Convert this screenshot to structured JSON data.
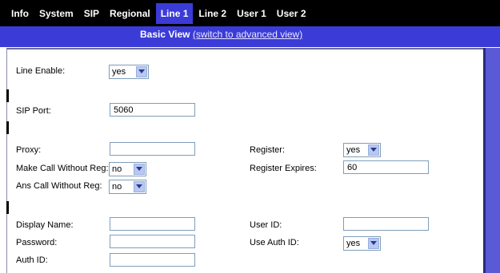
{
  "tabs": [
    "Info",
    "System",
    "SIP",
    "Regional",
    "Line 1",
    "Line 2",
    "User 1",
    "User 2"
  ],
  "active_tab": "Line 1",
  "view": {
    "title": "Basic View",
    "switch_link": "(switch to advanced view)"
  },
  "fields": {
    "line_enable": {
      "label": "Line Enable:",
      "value": "yes"
    },
    "sip_port": {
      "label": "SIP Port:",
      "value": "5060"
    },
    "proxy": {
      "label": "Proxy:",
      "value": ""
    },
    "register": {
      "label": "Register:",
      "value": "yes"
    },
    "make_call_without_reg": {
      "label": "Make Call Without Reg:",
      "value": "no"
    },
    "register_expires": {
      "label": "Register Expires:",
      "value": "60"
    },
    "ans_call_without_reg": {
      "label": "Ans Call Without Reg:",
      "value": "no"
    },
    "display_name": {
      "label": "Display Name:",
      "value": ""
    },
    "user_id": {
      "label": "User ID:",
      "value": ""
    },
    "password": {
      "label": "Password:",
      "value": ""
    },
    "use_auth_id": {
      "label": "Use Auth ID:",
      "value": "yes"
    },
    "auth_id": {
      "label": "Auth ID:",
      "value": ""
    }
  },
  "colors": {
    "tab_bar": "#000000",
    "accent": "#3b3bd8",
    "right_border": "#5a5ad6"
  }
}
